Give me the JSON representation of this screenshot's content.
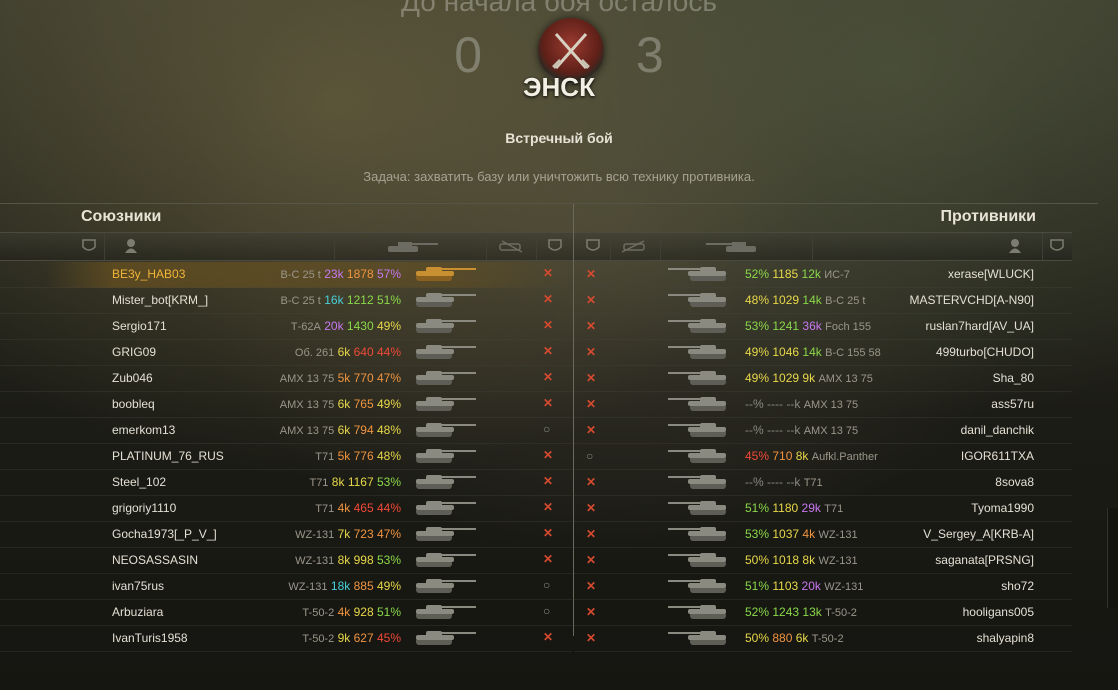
{
  "header": {
    "countdown_text": "До начала боя осталось",
    "timer": "0 3",
    "map_name": "ЭНСК",
    "battle_type": "Встречный бой",
    "task": "Задача: захватить базу или уничтожить всю технику противника."
  },
  "teams": {
    "left_title": "Союзники",
    "right_title": "Противники"
  },
  "allies": [
    {
      "name": "BE3y_HAB03",
      "vehicle": "В-С 25 t",
      "b": "23k",
      "b_c": "c-p",
      "w": "1878",
      "w_c": "c-o",
      "p": "57%",
      "p_c": "c-p",
      "status": "✕",
      "self": true
    },
    {
      "name": "Mister_bot[KRM_]",
      "vehicle": "В-С 25 t",
      "b": "16k",
      "b_c": "c-c",
      "w": "1212",
      "w_c": "c-g",
      "p": "51%",
      "p_c": "c-g",
      "status": "✕"
    },
    {
      "name": "Sergio171",
      "vehicle": "Т-62А",
      "b": "20k",
      "b_c": "c-p",
      "w": "1430",
      "w_c": "c-g",
      "p": "49%",
      "p_c": "c-y",
      "status": "✕"
    },
    {
      "name": "GRIG09",
      "vehicle": "Об. 261",
      "b": "6k",
      "b_c": "c-y",
      "w": "640",
      "w_c": "c-r",
      "p": "44%",
      "p_c": "c-r",
      "status": "✕"
    },
    {
      "name": "Zub046",
      "vehicle": "AMX 13 75",
      "b": "5k",
      "b_c": "c-o",
      "w": "770",
      "w_c": "c-o",
      "p": "47%",
      "p_c": "c-o",
      "status": "✕"
    },
    {
      "name": "boobleq",
      "vehicle": "AMX 13 75",
      "b": "6k",
      "b_c": "c-y",
      "w": "765",
      "w_c": "c-o",
      "p": "49%",
      "p_c": "c-y",
      "status": "✕"
    },
    {
      "name": "emerkom13",
      "vehicle": "AMX 13 75",
      "b": "6k",
      "b_c": "c-y",
      "w": "794",
      "w_c": "c-o",
      "p": "48%",
      "p_c": "c-y",
      "status": "○"
    },
    {
      "name": "PLATINUM_76_RUS",
      "vehicle": "T71",
      "b": "5k",
      "b_c": "c-o",
      "w": "776",
      "w_c": "c-o",
      "p": "48%",
      "p_c": "c-y",
      "status": "✕"
    },
    {
      "name": "Steel_102",
      "vehicle": "T71",
      "b": "8k",
      "b_c": "c-y",
      "w": "1167",
      "w_c": "c-y",
      "p": "53%",
      "p_c": "c-g",
      "status": "✕"
    },
    {
      "name": "grigoriy1110",
      "vehicle": "T71",
      "b": "4k",
      "b_c": "c-o",
      "w": "465",
      "w_c": "c-r",
      "p": "44%",
      "p_c": "c-r",
      "status": "✕"
    },
    {
      "name": "Gocha1973[_P_V_]",
      "vehicle": "WZ-131",
      "b": "7k",
      "b_c": "c-y",
      "w": "723",
      "w_c": "c-o",
      "p": "47%",
      "p_c": "c-o",
      "status": "✕"
    },
    {
      "name": "NEOSASSASIN",
      "vehicle": "WZ-131",
      "b": "8k",
      "b_c": "c-y",
      "w": "998",
      "w_c": "c-y",
      "p": "53%",
      "p_c": "c-g",
      "status": "✕"
    },
    {
      "name": "ivan75rus",
      "vehicle": "WZ-131",
      "b": "18k",
      "b_c": "c-c",
      "w": "885",
      "w_c": "c-o",
      "p": "49%",
      "p_c": "c-y",
      "status": "○"
    },
    {
      "name": "Arbuziara",
      "vehicle": "T-50-2",
      "b": "4k",
      "b_c": "c-o",
      "w": "928",
      "w_c": "c-y",
      "p": "51%",
      "p_c": "c-g",
      "status": "○"
    },
    {
      "name": "IvanTuris1958",
      "vehicle": "T-50-2",
      "b": "9k",
      "b_c": "c-y",
      "w": "627",
      "w_c": "c-o",
      "p": "45%",
      "p_c": "c-r",
      "status": "✕"
    }
  ],
  "enemies": [
    {
      "name": "xerase[WLUCK]",
      "vehicle": "ИС-7",
      "p": "52%",
      "p_c": "c-g",
      "w": "1185",
      "w_c": "c-y",
      "b": "12k",
      "b_c": "c-g",
      "status": "✕"
    },
    {
      "name": "MASTERVCHD[A-N90]",
      "vehicle": "В-С 25 t",
      "p": "48%",
      "p_c": "c-y",
      "w": "1029",
      "w_c": "c-y",
      "b": "14k",
      "b_c": "c-g",
      "status": "✕"
    },
    {
      "name": "ruslan7hard[AV_UA]",
      "vehicle": "Foch 155",
      "p": "53%",
      "p_c": "c-g",
      "w": "1241",
      "w_c": "c-g",
      "b": "36k",
      "b_c": "c-p",
      "status": "✕"
    },
    {
      "name": "499turbo[CHUDO]",
      "vehicle": "В-С 155 58",
      "p": "49%",
      "p_c": "c-y",
      "w": "1046",
      "w_c": "c-y",
      "b": "14k",
      "b_c": "c-g",
      "status": "✕"
    },
    {
      "name": "Sha_80",
      "vehicle": "AMX 13 75",
      "p": "49%",
      "p_c": "c-y",
      "w": "1029",
      "w_c": "c-y",
      "b": "9k",
      "b_c": "c-y",
      "status": "✕"
    },
    {
      "name": "ass57ru",
      "vehicle": "AMX 13 75",
      "p": "--%",
      "p_c": "c-gr",
      "w": "----",
      "w_c": "c-gr",
      "b": "--k",
      "b_c": "c-gr",
      "status": "✕"
    },
    {
      "name": "danil_danchik",
      "vehicle": "AMX 13 75",
      "p": "--%",
      "p_c": "c-gr",
      "w": "----",
      "w_c": "c-gr",
      "b": "--k",
      "b_c": "c-gr",
      "status": "✕"
    },
    {
      "name": "IGOR611TXA",
      "vehicle": "Aufkl.Panther",
      "p": "45%",
      "p_c": "c-r",
      "w": "710",
      "w_c": "c-o",
      "b": "8k",
      "b_c": "c-y",
      "status": "○"
    },
    {
      "name": "8sova8",
      "vehicle": "T71",
      "p": "--%",
      "p_c": "c-gr",
      "w": "----",
      "w_c": "c-gr",
      "b": "--k",
      "b_c": "c-gr",
      "status": "✕"
    },
    {
      "name": "Tyoma1990",
      "vehicle": "T71",
      "p": "51%",
      "p_c": "c-g",
      "w": "1180",
      "w_c": "c-y",
      "b": "29k",
      "b_c": "c-p",
      "status": "✕"
    },
    {
      "name": "V_Sergey_A[KRB-A]",
      "vehicle": "WZ-131",
      "p": "53%",
      "p_c": "c-g",
      "w": "1037",
      "w_c": "c-y",
      "b": "4k",
      "b_c": "c-o",
      "status": "✕"
    },
    {
      "name": "saganata[PRSNG]",
      "vehicle": "WZ-131",
      "p": "50%",
      "p_c": "c-y",
      "w": "1018",
      "w_c": "c-y",
      "b": "8k",
      "b_c": "c-y",
      "status": "✕"
    },
    {
      "name": "sho72",
      "vehicle": "WZ-131",
      "p": "51%",
      "p_c": "c-g",
      "w": "1103",
      "w_c": "c-y",
      "b": "20k",
      "b_c": "c-p",
      "status": "✕"
    },
    {
      "name": "hooligans005",
      "vehicle": "T-50-2",
      "p": "52%",
      "p_c": "c-g",
      "w": "1243",
      "w_c": "c-g",
      "b": "13k",
      "b_c": "c-g",
      "status": "✕"
    },
    {
      "name": "shalyapin8",
      "vehicle": "T-50-2",
      "p": "50%",
      "p_c": "c-y",
      "w": "880",
      "w_c": "c-o",
      "b": "6k",
      "b_c": "c-y",
      "status": "✕"
    }
  ],
  "icons": {
    "shield": "shield-icon",
    "player": "player-icon",
    "tank": "tank-icon",
    "frags": "destroyed-tank-icon"
  },
  "colors": {
    "accent": "#f0b438",
    "dead": "#d64a30"
  }
}
